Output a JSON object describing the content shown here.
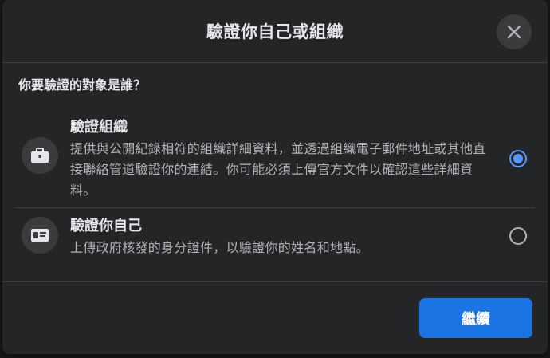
{
  "dialog": {
    "title": "驗證你自己或組織",
    "question": "你要驗證的對象是誰？"
  },
  "options": [
    {
      "title": "驗證組織",
      "description": "提供與公開紀錄相符的組織詳細資料，並透過組織電子郵件地址或其他直接聯絡管道驗證你的連結。你可能必須上傳官方文件以確認這些詳細資料。",
      "icon": "briefcase-icon",
      "selected": true
    },
    {
      "title": "驗證你自己",
      "description": "上傳政府核發的身分證件，以驗證你的姓名和地點。",
      "icon": "id-card-icon",
      "selected": false
    }
  ],
  "footer": {
    "continue_label": "繼續"
  },
  "colors": {
    "background": "#242526",
    "accent": "#1b74e4",
    "radio_selected": "#5599ff"
  }
}
